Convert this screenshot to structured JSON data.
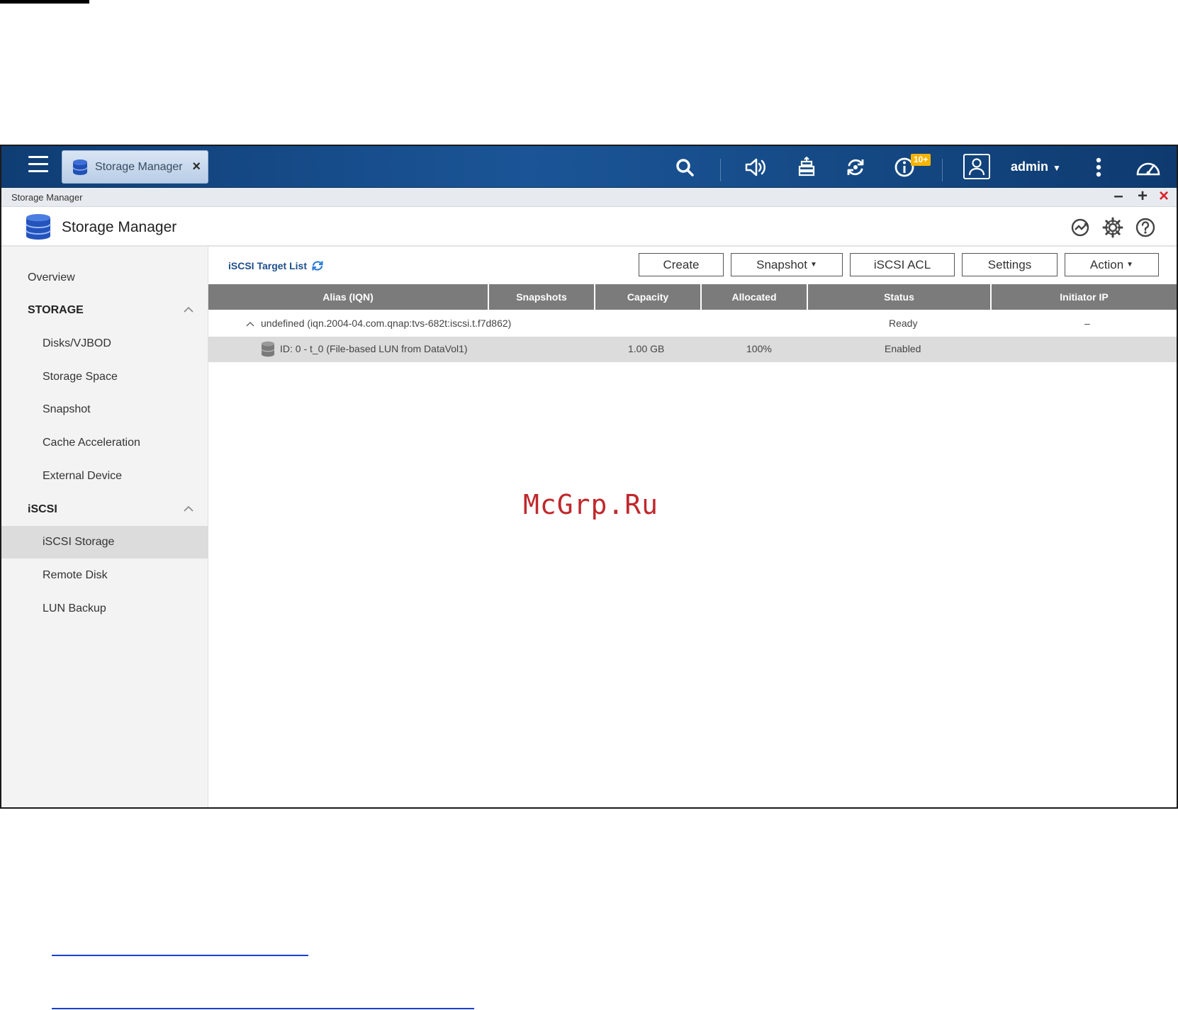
{
  "taskbar": {
    "tab_label": "Storage Manager",
    "notification_badge": "10+",
    "user_name": "admin"
  },
  "window": {
    "title": "Storage Manager"
  },
  "app_header": {
    "title": "Storage Manager"
  },
  "sidebar": {
    "items": [
      {
        "label": "Overview"
      },
      {
        "label": "STORAGE"
      },
      {
        "label": "Disks/VJBOD"
      },
      {
        "label": "Storage Space"
      },
      {
        "label": "Snapshot"
      },
      {
        "label": "Cache Acceleration"
      },
      {
        "label": "External Device"
      },
      {
        "label": "iSCSI"
      },
      {
        "label": "iSCSI Storage"
      },
      {
        "label": "Remote Disk"
      },
      {
        "label": "LUN Backup"
      }
    ],
    "active": "iSCSI Storage"
  },
  "main": {
    "list_title": "iSCSI Target List",
    "buttons": {
      "create": "Create",
      "snapshot": "Snapshot",
      "iscsi_acl": "iSCSI ACL",
      "settings": "Settings",
      "action": "Action"
    },
    "columns": [
      "Alias (IQN)",
      "Snapshots",
      "Capacity",
      "Allocated",
      "Status",
      "Initiator IP"
    ],
    "target": {
      "alias": "undefined (iqn.2004-04.com.qnap:tvs-682t:iscsi.t.f7d862)",
      "status": "Ready",
      "initiator_ip": "–"
    },
    "lun": {
      "alias": "ID: 0 - t_0 (File-based LUN from DataVol1)",
      "capacity": "1.00 GB",
      "allocated": "100%",
      "status": "Enabled"
    }
  },
  "watermark": "McGrp.Ru",
  "colors": {
    "taskbar": "#1b5597",
    "table_header": "#7b7b7b",
    "selected_row": "#dcdcdc",
    "close_red": "#d9232a",
    "link_blue": "#1a3fd6",
    "watermark": "#c0282c"
  }
}
